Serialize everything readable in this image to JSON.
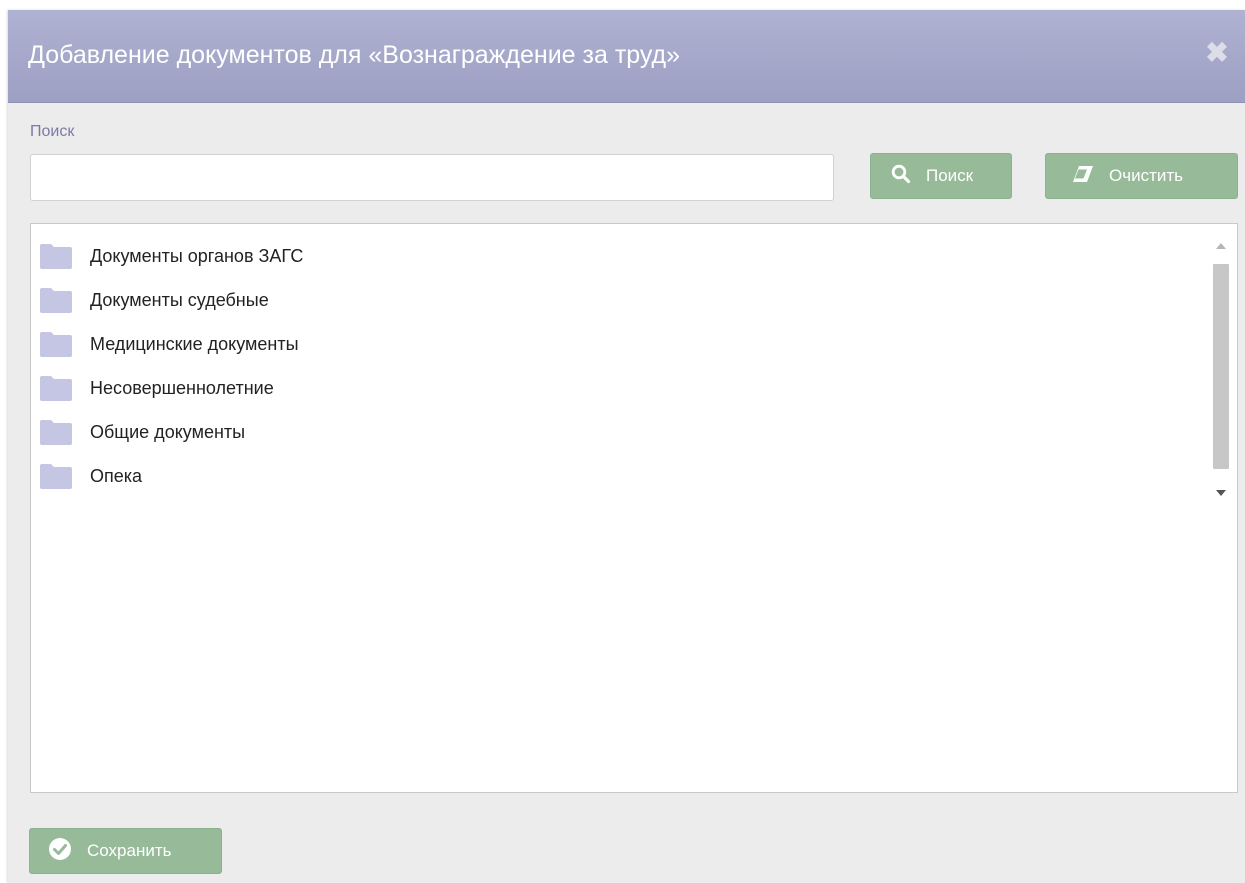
{
  "dialog": {
    "title": "Добавление документов для «Вознаграждение за труд»",
    "close_icon": "close-icon"
  },
  "search": {
    "label": "Поиск",
    "value": "",
    "placeholder": "",
    "search_button_label": "Поиск",
    "clear_button_label": "Очистить"
  },
  "tree": {
    "items": [
      {
        "label": "Документы органов ЗАГС",
        "icon": "folder-icon"
      },
      {
        "label": "Документы судебные",
        "icon": "folder-icon"
      },
      {
        "label": "Медицинские документы",
        "icon": "folder-icon"
      },
      {
        "label": "Несовершеннолетние",
        "icon": "folder-icon"
      },
      {
        "label": "Общие документы",
        "icon": "folder-icon"
      },
      {
        "label": "Опека",
        "icon": "folder-icon"
      }
    ]
  },
  "footer": {
    "save_button_label": "Сохранить"
  },
  "colors": {
    "titlebar": "#a6a8ca",
    "button_green": "#97bb99",
    "folder": "#c4c6e3",
    "label_accent": "#7c7aa4"
  }
}
